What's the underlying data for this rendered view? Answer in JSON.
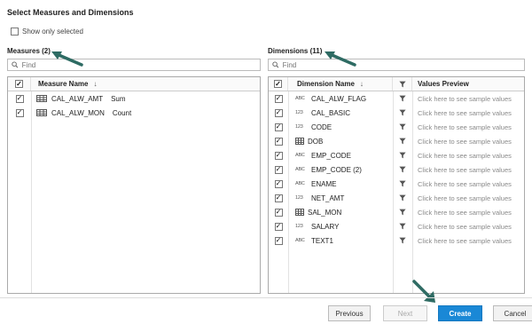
{
  "dialog": {
    "title": "Select Measures and Dimensions",
    "show_only_selected": "Show only selected"
  },
  "measures": {
    "label": "Measures (2)",
    "search_placeholder": "Find",
    "header": "Measure Name",
    "rows": [
      {
        "name": "CAL_ALW_AMT",
        "aggregation": "Sum",
        "checked": true
      },
      {
        "name": "CAL_ALW_MON",
        "aggregation": "Count",
        "checked": true
      }
    ]
  },
  "dimensions": {
    "label": "Dimensions (11)",
    "search_placeholder": "Find",
    "header_name": "Dimension Name",
    "header_preview": "Values Preview",
    "sample_text": "Click here to see sample values",
    "rows": [
      {
        "type": "ABC",
        "name": "CAL_ALW_FLAG",
        "checked": true
      },
      {
        "type": "123",
        "name": "CAL_BASIC",
        "checked": true
      },
      {
        "type": "123",
        "name": "CODE",
        "checked": true
      },
      {
        "type": "table",
        "name": "DOB",
        "checked": true
      },
      {
        "type": "ABC",
        "name": "EMP_CODE",
        "checked": true
      },
      {
        "type": "ABC",
        "name": "EMP_CODE (2)",
        "checked": true
      },
      {
        "type": "ABC",
        "name": "ENAME",
        "checked": true
      },
      {
        "type": "123",
        "name": "NET_AMT",
        "checked": true
      },
      {
        "type": "table",
        "name": "SAL_MON",
        "checked": true
      },
      {
        "type": "123",
        "name": "SALARY",
        "checked": true
      },
      {
        "type": "ABC",
        "name": "TEXT1",
        "checked": true
      }
    ]
  },
  "footer": {
    "previous": "Previous",
    "next": "Next",
    "create": "Create",
    "cancel": "Cancel"
  },
  "colors": {
    "primary_button": "#1a88d6",
    "annotation_arrow": "#2e6b63"
  }
}
